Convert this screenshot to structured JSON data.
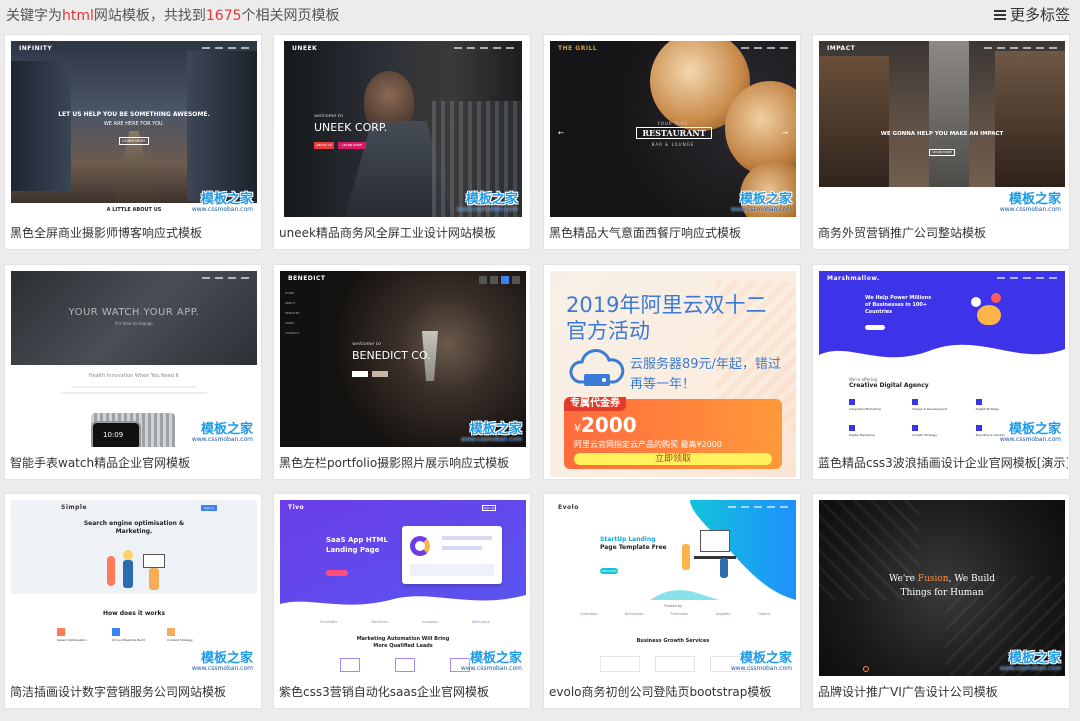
{
  "header": {
    "prefix": "关键字为",
    "keyword": "html",
    "mid": "网站模板，共找到",
    "count": "1675",
    "suffix": "个相关网页模板",
    "more_tags": "更多标签"
  },
  "watermark": {
    "main": "模板之家",
    "url": "www.cssmoban.com"
  },
  "templates": [
    {
      "caption": "黑色全屏商业摄影师博客响应式模板",
      "preview": {
        "brand": "INFINITY",
        "headline": "LET US HELP YOU BE SOMETHING AWESOME.",
        "sub": "WE ARE HERE FOR YOU.",
        "button": "LEARN MORE",
        "footer": "A LITTLE ABOUT US"
      }
    },
    {
      "caption": "uneek精品商务风全屏工业设计网站模板",
      "preview": {
        "brand": "UNEEK",
        "welcome": "welcome to",
        "headline": "UNEEK CORP.",
        "btn1": "ABOUT US",
        "btn2": "LEARN MORE"
      }
    },
    {
      "caption": "黑色精品大气意面西餐厅响应式模板",
      "preview": {
        "brand": "THE GRILL",
        "tag": "YOUR TIME",
        "headline": "RESTAURANT",
        "sub": "BAR & LOUNGE"
      }
    },
    {
      "caption": "商务外贸营销推广公司整站模板",
      "preview": {
        "brand": "IMPACT",
        "headline": "WE GONNA HELP YOU MAKE AN IMPACT",
        "button": "LEARN MORE"
      }
    },
    {
      "caption": "智能手表watch精品企业官网模板",
      "preview": {
        "headline": "YOUR WATCH YOUR APP.",
        "sub": "It's time to change",
        "section": "Health Innovation When You Need It",
        "clock": "10:09"
      }
    },
    {
      "caption": "黑色左栏portfolio摄影照片展示响应式模板",
      "preview": {
        "brand": "BENEDICT",
        "welcome": "welcome to",
        "headline": "BENEDICT CO.",
        "menu": [
          "HOME",
          "ABOUT",
          "SERVICES",
          "WORK",
          "CONTACT"
        ]
      }
    },
    {
      "caption": "",
      "preview": {
        "title_line1": "2019年阿里云双十二",
        "title_line2": "官方活动",
        "promo_line1": "云服务器89元/年起，错过",
        "promo_line2": "再等一年！",
        "badge": "专属代金券",
        "currency": "¥",
        "amount": "2000",
        "note": "阿里云官网指定云产品的购买 最高¥2000",
        "button": "立即领取"
      }
    },
    {
      "caption": "蓝色精品css3波浪插画设计企业官网模板[演示]",
      "preview": {
        "brand": "Marshmallow.",
        "headline_line1": "We Help Power Millions",
        "headline_line2": "of Businesses in 100+",
        "headline_line3": "Countries",
        "section_small": "We're offering",
        "section": "Creative Digital Agency",
        "features": [
          "Integrated Marketing",
          "Design & Development",
          "Digital Strategy",
          "Digital Marketing",
          "Growth Strategy",
          "Branding & Identity"
        ]
      }
    },
    {
      "caption": "简洁插画设计数字营销服务公司网站模板",
      "preview": {
        "brand": "Simple",
        "button": "Sign In",
        "headline_line1": "Search engine optimisation &",
        "headline_line2": "Marketing.",
        "section": "How does it works",
        "steps": [
          "Speed Optimisation",
          "UX and Backlink Build",
          "Content Strategy"
        ]
      }
    },
    {
      "caption": "紫色css3营销自动化saas企业官网模板",
      "preview": {
        "brand": "Tivo",
        "button": "Sign Up",
        "headline_line1": "SaaS App HTML",
        "headline_line2": "Landing Page",
        "logos": [
          "SmartDev",
          "Backfeed",
          "GrowApp",
          "Workplace"
        ],
        "section_line1": "Marketing Automation Will Bring",
        "section_line2": "More Qualified Leads"
      }
    },
    {
      "caption": "evolo商务初创公司登陆页bootstrap模板",
      "preview": {
        "brand": "Evolo",
        "headline_line1": "StartUp Landing",
        "headline_line2": "Page Template Free",
        "button": "DISCOVER",
        "trusted": "Trusted by",
        "logos": [
          "GreenApp",
          "Netmarker",
          "Promotion",
          "ArgoDev",
          "Optimt"
        ],
        "section": "Business Growth Services"
      }
    },
    {
      "caption": "品牌设计推广VI广告设计公司模板",
      "preview": {
        "headline_pre": "We're ",
        "headline_accent": "Fusion",
        "headline_post": ", We Build",
        "headline_line2": "Things for Human"
      }
    }
  ]
}
